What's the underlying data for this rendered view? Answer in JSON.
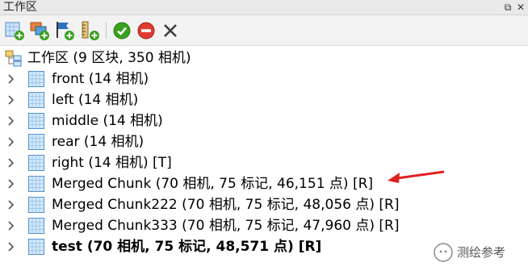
{
  "window": {
    "title": "工作区",
    "float_glyph": "⧉",
    "close_glyph": "✕"
  },
  "toolbar": {
    "buttons": [
      {
        "name": "add-chunk-icon"
      },
      {
        "name": "add-photos-icon"
      },
      {
        "name": "add-markers-icon"
      },
      {
        "name": "add-scalebar-icon"
      },
      {
        "name": "enable-icon",
        "color": "#3aa21e"
      },
      {
        "name": "disable-icon",
        "color": "#e23b2f"
      },
      {
        "name": "remove-icon"
      }
    ]
  },
  "tree": {
    "root_label": "工作区 (9 区块, 350 相机)",
    "chunks": [
      {
        "label": "front (14 相机)",
        "bold": false
      },
      {
        "label": "left (14 相机)",
        "bold": false
      },
      {
        "label": "middle (14 相机)",
        "bold": false
      },
      {
        "label": "rear (14 相机)",
        "bold": false
      },
      {
        "label": "right (14 相机) [T]",
        "bold": false
      },
      {
        "label": "Merged Chunk (70 相机, 75 标记, 46,151 点) [R]",
        "bold": false
      },
      {
        "label": "Merged Chunk222 (70 相机, 75 标记, 48,056 点) [R]",
        "bold": false
      },
      {
        "label": "Merged Chunk333 (70 相机, 75 标记, 47,960 点) [R]",
        "bold": false
      },
      {
        "label": "test (70 相机, 75 标记, 48,571 点) [R]",
        "bold": true
      }
    ]
  },
  "annotation": {
    "arrow_color": "#e02020"
  },
  "watermark": {
    "text": "测绘参考"
  }
}
